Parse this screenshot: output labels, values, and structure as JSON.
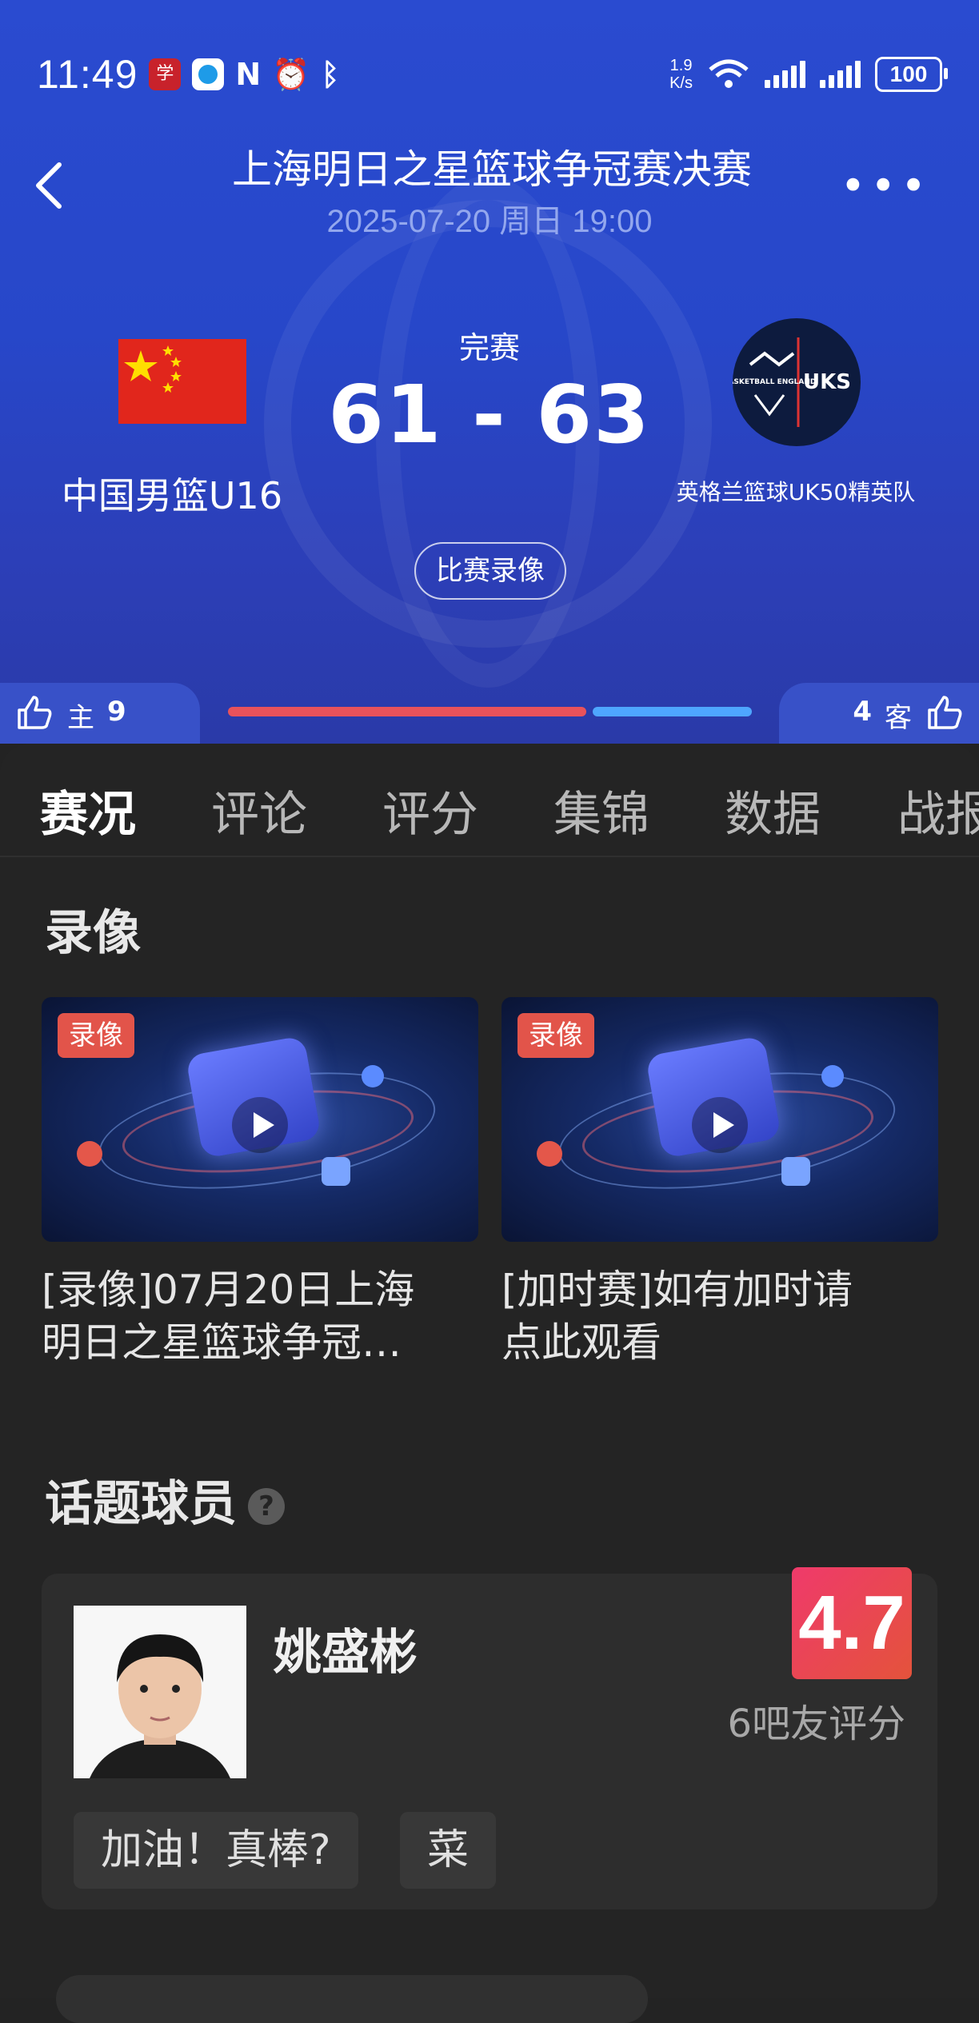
{
  "status_bar": {
    "time": "11:49",
    "net_speed_value": "1.9",
    "net_speed_unit": "K/s",
    "battery": "100",
    "icons": [
      "app-badge-icon",
      "app-browser-icon",
      "nfc-icon",
      "alarm-icon",
      "bluetooth-icon",
      "wifi-icon",
      "signal-icon",
      "signal-icon",
      "battery-icon"
    ]
  },
  "header": {
    "title": "上海明日之星篮球争冠赛决赛",
    "datetime": "2025-07-20 周日 19:00"
  },
  "match": {
    "status": "完赛",
    "score": "61 - 63",
    "home_team": "中国男篮U16",
    "away_team": "英格兰篮球UK50精英队",
    "replay_button": "比赛录像",
    "away_logo_text": "UKS",
    "away_logo_sub": "BASKETBALL ENGLAND"
  },
  "support": {
    "home_label": "主",
    "home_count": "9",
    "away_label": "客",
    "away_count": "4",
    "home_color": "#e8525b",
    "away_color": "#4ea6ff"
  },
  "tabs": [
    "赛况",
    "评论",
    "评分",
    "集锦",
    "数据",
    "战报"
  ],
  "videos_section": {
    "title": "录像",
    "items": [
      {
        "badge": "录像",
        "caption_line1": "[录像]07月20日上海",
        "caption_line2": "明日之星篮球争冠…"
      },
      {
        "badge": "录像",
        "caption_line1": "[加时赛]如有加时请",
        "caption_line2": "点此观看"
      }
    ]
  },
  "players_section": {
    "title": "话题球员",
    "help": "?",
    "player": {
      "name": "姚盛彬",
      "rating": "4.7",
      "raters": "6吧友评分",
      "tags": [
        "加油！真棒?",
        "菜"
      ]
    }
  },
  "colors": {
    "hero_blue": "#2a4bd0",
    "panel_bg": "#242424",
    "accent_blue": "#3a8df0",
    "rating_red": "#e4533b"
  }
}
